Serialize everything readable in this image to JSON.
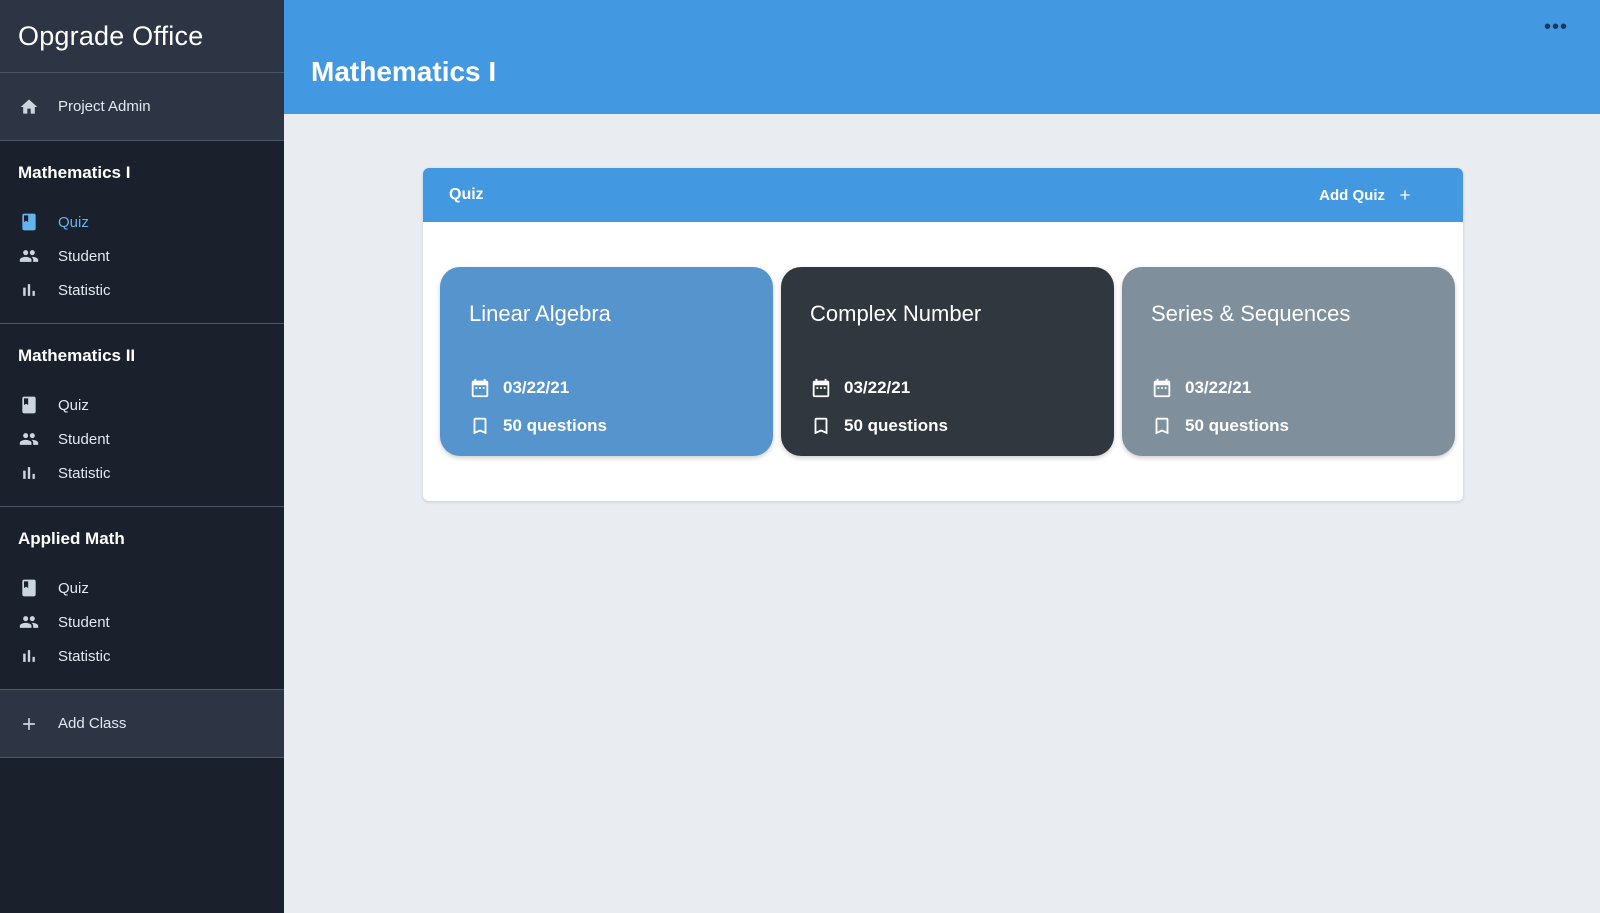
{
  "app": {
    "brand": "Opgrade Office"
  },
  "sidebar": {
    "admin_label": "Project Admin",
    "classes": [
      {
        "title": "Mathematics I",
        "items": [
          "Quiz",
          "Student",
          "Statistic"
        ],
        "active": "Quiz"
      },
      {
        "title": "Mathematics II",
        "items": [
          "Quiz",
          "Student",
          "Statistic"
        ]
      },
      {
        "title": "Applied Math",
        "items": [
          "Quiz",
          "Student",
          "Statistic"
        ]
      }
    ],
    "add_class_label": "Add Class"
  },
  "header": {
    "title": "Mathematics I",
    "more_icon": "more-horizontal-icon"
  },
  "panel": {
    "title": "Quiz",
    "add_label": "Add Quiz",
    "cards": [
      {
        "title": "Linear Algebra",
        "date": "03/22/21",
        "questions": "50 questions",
        "color": "#5594cd"
      },
      {
        "title": "Complex Number",
        "date": "03/22/21",
        "questions": "50 questions",
        "color": "#30373f"
      },
      {
        "title": "Series & Sequences",
        "date": "03/22/21",
        "questions": "50 questions",
        "color": "#7f8f9c"
      }
    ]
  },
  "colors": {
    "accent": "#4299e1",
    "sidebar_bg": "#1a202c",
    "active_link": "#63b3ed"
  }
}
